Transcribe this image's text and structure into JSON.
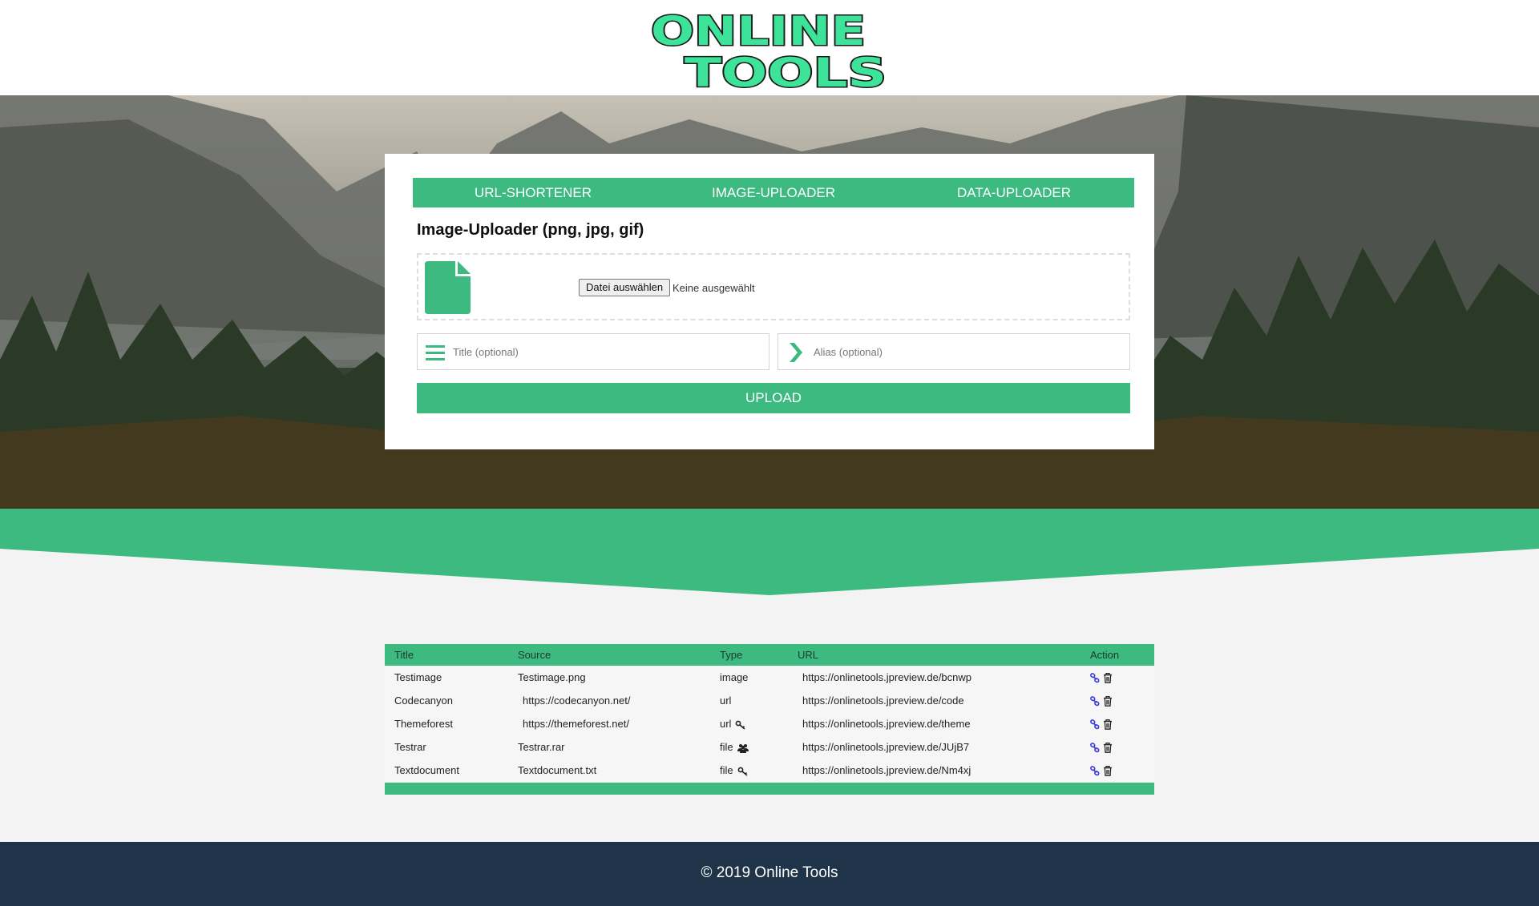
{
  "brand": {
    "logo_line1": "ONLINE",
    "logo_line2": "TOOLS",
    "accent": "#3dba80",
    "footer_bg": "#1f3448"
  },
  "tabs": [
    {
      "label": "URL-SHORTENER"
    },
    {
      "label": "IMAGE-UPLOADER"
    },
    {
      "label": "DATA-UPLOADER"
    }
  ],
  "uploader": {
    "title": "Image-Uploader (png, jpg, gif)",
    "file_icon": "file-icon",
    "choose_file_label": "Datei auswählen",
    "no_file_text": "Keine ausgewählt",
    "title_placeholder": "Title (optional)",
    "title_icon": "menu-icon",
    "alias_placeholder": "Alias (optional)",
    "alias_icon": "chevron-right-icon",
    "upload_label": "UPLOAD"
  },
  "table": {
    "headers": {
      "title": "Title",
      "source": "Source",
      "type": "Type",
      "url": "URL",
      "action": "Action"
    },
    "rows": [
      {
        "title": "Testimage",
        "source": "Testimage.png",
        "type": "image",
        "type_icon": "",
        "url": "https://onlinetools.jpreview.de/bcnwp"
      },
      {
        "title": "Codecanyon",
        "source": "https://codecanyon.net/",
        "type": "url",
        "type_icon": "",
        "url": "https://onlinetools.jpreview.de/code"
      },
      {
        "title": "Themeforest",
        "source": "https://themeforest.net/",
        "type": "url",
        "type_icon": "key-icon",
        "url": "https://onlinetools.jpreview.de/theme"
      },
      {
        "title": "Testrar",
        "source": "Testrar.rar",
        "type": "file",
        "type_icon": "users-icon",
        "url": "https://onlinetools.jpreview.de/JUjB7"
      },
      {
        "title": "Textdocument",
        "source": "Textdocument.txt",
        "type": "file",
        "type_icon": "key-icon",
        "url": "https://onlinetools.jpreview.de/Nm4xj"
      }
    ],
    "action_icons": [
      "link-icon",
      "trash-icon"
    ]
  },
  "footer": {
    "text": "© 2019 Online Tools"
  }
}
